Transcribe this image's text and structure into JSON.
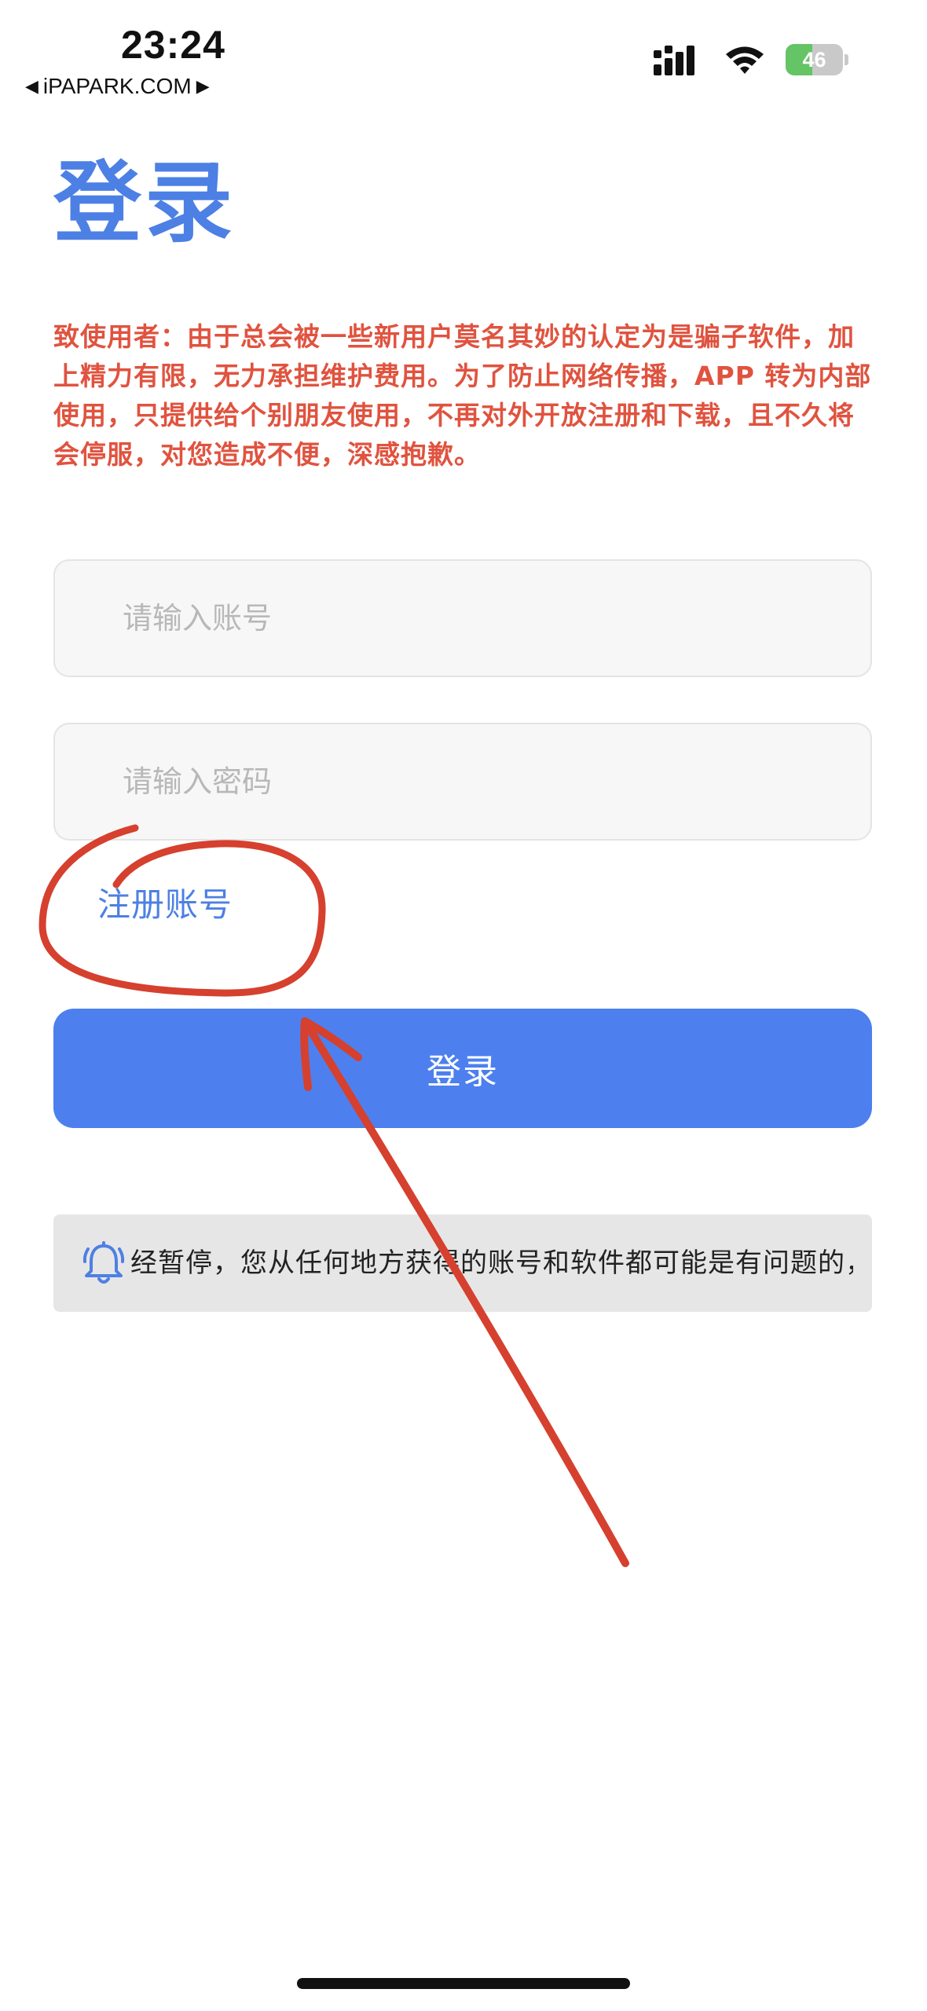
{
  "status_bar": {
    "time": "23:24",
    "back_label": "iPAPARK.COM",
    "battery_level": "46",
    "battery_fraction": 0.46
  },
  "page": {
    "title": "登录",
    "notice": "致使用者：由于总会被一些新用户莫名其妙的认定为是骗子软件，加上精力有限，无力承担维护费用。为了防止网络传播，APP 转为内部使用，只提供给个别朋友使用，不再对外开放注册和下载，且不久将会停服，对您造成不便，深感抱歉。"
  },
  "form": {
    "account_placeholder": "请输入账号",
    "password_placeholder": "请输入密码",
    "register_label": "注册账号",
    "login_label": "登录"
  },
  "announcement": {
    "text": "经暂停，您从任何地方获得的账号和软件都可能是有问题的，谨防"
  },
  "icons": {
    "back": "triangle-left-icon",
    "forward": "triangle-right-icon",
    "signal": "cellular-signal-icon",
    "wifi": "wifi-icon",
    "battery": "battery-charging-icon",
    "bell": "bell-icon"
  },
  "colors": {
    "accent": "#4d80e4",
    "button": "#4d80ee",
    "warning": "#e0533f",
    "annotation": "#d6402e",
    "battery": "#65c466"
  }
}
